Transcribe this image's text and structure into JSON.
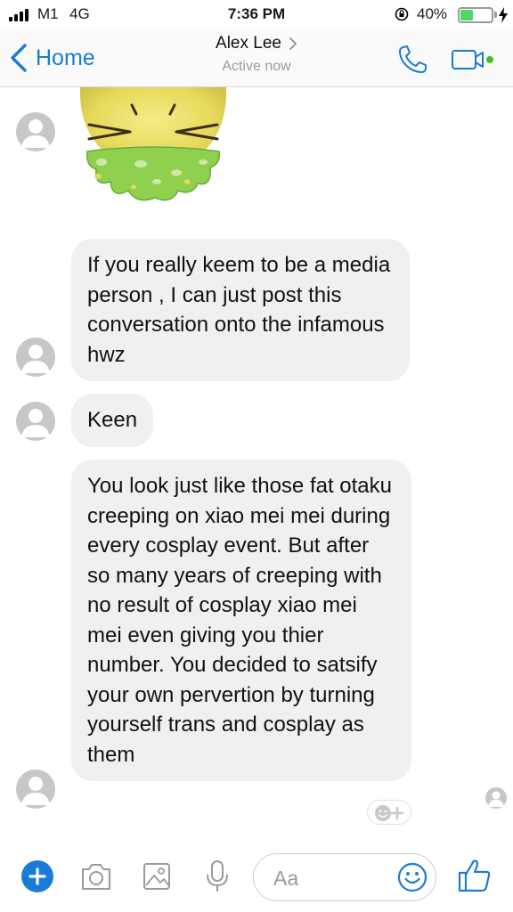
{
  "status_bar": {
    "carrier": "M1",
    "network": "4G",
    "time": "7:36 PM",
    "battery_percent": "40%",
    "battery_level": 0.4,
    "icons": [
      "signal-bars-icon",
      "orientation-lock-icon",
      "battery-icon",
      "charging-bolt-icon"
    ]
  },
  "header": {
    "back_label": "Home",
    "contact_name": "Alex Lee",
    "contact_status": "Active now",
    "icons": [
      "back-chevron-icon",
      "phone-icon",
      "video-camera-icon"
    ],
    "active_dot_color": "#44bd32"
  },
  "messages": [
    {
      "type": "sticker",
      "sticker": "vomiting-face-sticker"
    },
    {
      "type": "text",
      "text": "If you really keem to be a media person , I can just post this conversation onto the infamous hwz"
    },
    {
      "type": "text",
      "text": "Keen"
    },
    {
      "type": "text",
      "text": "You look just like those fat otaku creeping on xiao mei mei during every cosplay event. But after so many years of creeping with no result of cosplay xiao mei mei even giving you thier number. You decided to satsify your own pervertion by turning yourself trans and cosplay as them"
    }
  ],
  "composer": {
    "placeholder": "Aa",
    "icons": [
      "plus-icon",
      "camera-icon",
      "image-icon",
      "microphone-icon",
      "emoji-icon",
      "thumbs-up-icon"
    ]
  },
  "colors": {
    "accent": "#1a7bd6",
    "bubble": "#f1f0f0",
    "sticker_face": "#e9e26a",
    "sticker_slime": "#8fd14f"
  }
}
